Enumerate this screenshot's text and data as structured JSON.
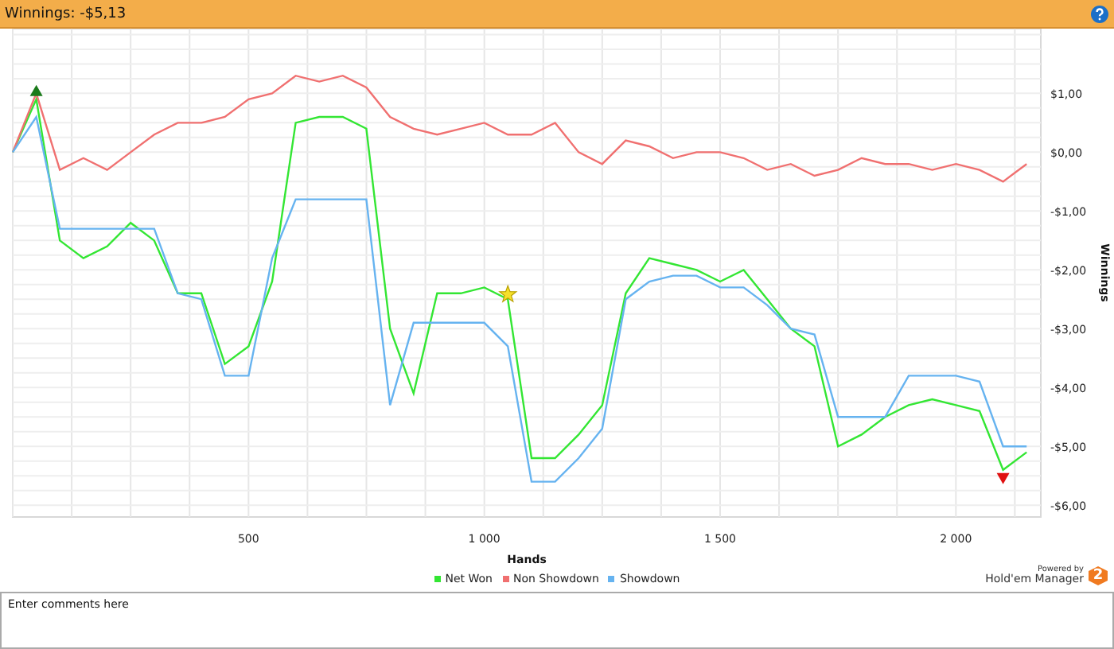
{
  "title_bar": {
    "title": "Winnings: -$5,13"
  },
  "chart": {
    "chart_data": {
      "type": "line",
      "xlabel": "Hands",
      "ylabel": "Winnings",
      "x": [
        0,
        50,
        100,
        150,
        200,
        250,
        300,
        350,
        400,
        450,
        500,
        550,
        600,
        650,
        700,
        750,
        800,
        850,
        900,
        950,
        1000,
        1050,
        1100,
        1150,
        1200,
        1250,
        1300,
        1350,
        1400,
        1450,
        1500,
        1550,
        1600,
        1650,
        1700,
        1750,
        1800,
        1850,
        1900,
        1950,
        2000,
        2050,
        2100,
        2150
      ],
      "series": [
        {
          "name": "Net Won",
          "color": "#33e633",
          "values": [
            0,
            0.9,
            -1.5,
            -1.8,
            -1.6,
            -1.2,
            -1.5,
            -2.4,
            -2.4,
            -3.6,
            -3.3,
            -2.2,
            0.5,
            0.6,
            0.6,
            0.4,
            -3.0,
            -4.1,
            -2.4,
            -2.4,
            -2.3,
            -2.5,
            -5.2,
            -5.2,
            -4.8,
            -4.3,
            -2.4,
            -1.8,
            -1.9,
            -2.0,
            -2.2,
            -2.0,
            -2.5,
            -3.0,
            -3.3,
            -5.0,
            -4.8,
            -4.5,
            -4.3,
            -4.2,
            -4.3,
            -4.4,
            -5.4,
            -5.1
          ]
        },
        {
          "name": "Non Showdown",
          "color": "#f07070",
          "values": [
            0,
            1.0,
            -0.3,
            -0.1,
            -0.3,
            0,
            0.3,
            0.5,
            0.5,
            0.6,
            0.9,
            1.0,
            1.3,
            1.2,
            1.3,
            1.1,
            0.6,
            0.4,
            0.3,
            0.4,
            0.5,
            0.3,
            0.3,
            0.5,
            0,
            -0.2,
            0.2,
            0.1,
            -0.1,
            0,
            0,
            -0.1,
            -0.3,
            -0.2,
            -0.4,
            -0.3,
            -0.1,
            -0.2,
            -0.2,
            -0.3,
            -0.2,
            -0.3,
            -0.5,
            -0.2
          ]
        },
        {
          "name": "Showdown",
          "color": "#66b3f0",
          "values": [
            0,
            0.6,
            -1.3,
            -1.3,
            -1.3,
            -1.3,
            -1.3,
            -2.4,
            -2.5,
            -3.8,
            -3.8,
            -1.8,
            -0.8,
            -0.8,
            -0.8,
            -0.8,
            -4.3,
            -2.9,
            -2.9,
            -2.9,
            -2.9,
            -3.3,
            -5.6,
            -5.6,
            -5.2,
            -4.7,
            -2.5,
            -2.2,
            -2.1,
            -2.1,
            -2.3,
            -2.3,
            -2.6,
            -3.0,
            -3.1,
            -4.5,
            -4.5,
            -4.5,
            -3.8,
            -3.8,
            -3.8,
            -3.9,
            -5.0,
            -5.0
          ]
        }
      ],
      "xlim": [
        0,
        2180
      ],
      "ylim": [
        -6.2,
        2.1
      ],
      "xticks": [
        {
          "value": 500,
          "label": "500"
        },
        {
          "value": 1000,
          "label": "1 000"
        },
        {
          "value": 1500,
          "label": "1 500"
        },
        {
          "value": 2000,
          "label": "2 000"
        }
      ],
      "yticks": [
        {
          "value": 1,
          "label": "$1,00"
        },
        {
          "value": 0,
          "label": "$0,00"
        },
        {
          "value": -1,
          "label": "-$1,00"
        },
        {
          "value": -2,
          "label": "-$2,00"
        },
        {
          "value": -3,
          "label": "-$3,00"
        },
        {
          "value": -4,
          "label": "-$4,00"
        },
        {
          "value": -5,
          "label": "-$5,00"
        },
        {
          "value": -6,
          "label": "-$6,00"
        }
      ],
      "grid": true
    }
  },
  "branding": {
    "caption": "Powered by",
    "product": "Hold'em Manager",
    "badge": "2"
  },
  "comments": {
    "placeholder": "Enter comments here"
  }
}
